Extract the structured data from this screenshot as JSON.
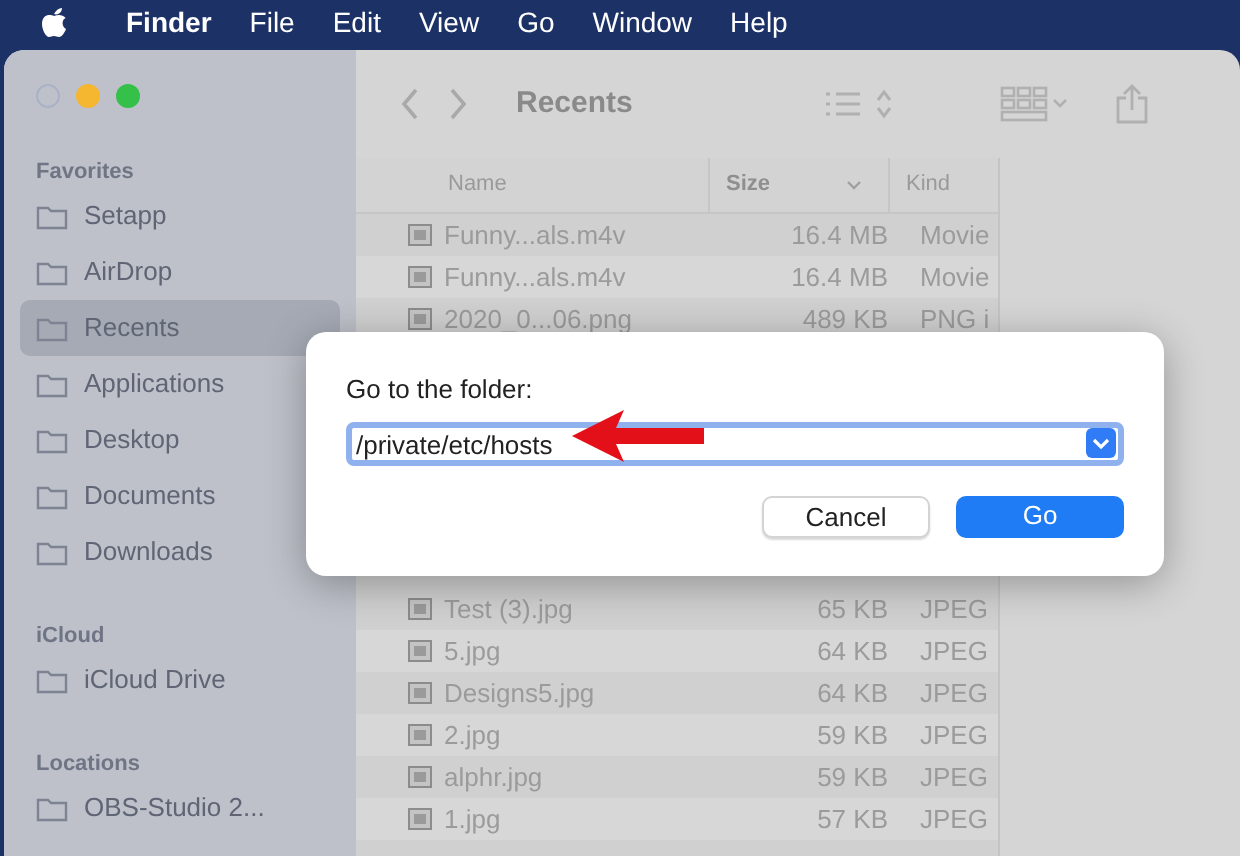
{
  "menu_bar": {
    "app_name": "Finder",
    "menus": [
      "File",
      "Edit",
      "View",
      "Go",
      "Window",
      "Help"
    ]
  },
  "window": {
    "title": "Recents",
    "sidebar": [
      {
        "heading": "Favorites",
        "items": [
          {
            "label": "Setapp",
            "selected": false
          },
          {
            "label": "AirDrop",
            "selected": false
          },
          {
            "label": "Recents",
            "selected": true
          },
          {
            "label": "Applications",
            "selected": false
          },
          {
            "label": "Desktop",
            "selected": false
          },
          {
            "label": "Documents",
            "selected": false
          },
          {
            "label": "Downloads",
            "selected": false
          }
        ]
      },
      {
        "heading": "iCloud",
        "items": [
          {
            "label": "iCloud Drive",
            "selected": false
          }
        ]
      },
      {
        "heading": "Locations",
        "items": [
          {
            "label": "OBS-Studio 2...",
            "selected": false
          }
        ]
      }
    ],
    "table": {
      "columns": [
        "Name",
        "Size",
        "Kind"
      ],
      "rows_above": [
        [
          "Funny...als.m4v",
          "16.4 MB",
          "Movie"
        ],
        [
          "Funny...als.m4v",
          "16.4 MB",
          "Movie"
        ],
        [
          "2020_0...06.png",
          "489 KB",
          "PNG i"
        ]
      ],
      "rows_below": [
        [
          "Test (3).jpg",
          "65 KB",
          "JPEG"
        ],
        [
          "5.jpg",
          "64 KB",
          "JPEG"
        ],
        [
          "Designs5.jpg",
          "64 KB",
          "JPEG"
        ],
        [
          "2.jpg",
          "59 KB",
          "JPEG"
        ],
        [
          "alphr.jpg",
          "59 KB",
          "JPEG"
        ],
        [
          "1.jpg",
          "57 KB",
          "JPEG"
        ]
      ]
    }
  },
  "dialog": {
    "prompt": "Go to the folder:",
    "value": "/private/etc/hosts",
    "buttons": [
      {
        "label": "Cancel",
        "primary": false
      },
      {
        "label": "Go",
        "primary": true
      }
    ]
  }
}
